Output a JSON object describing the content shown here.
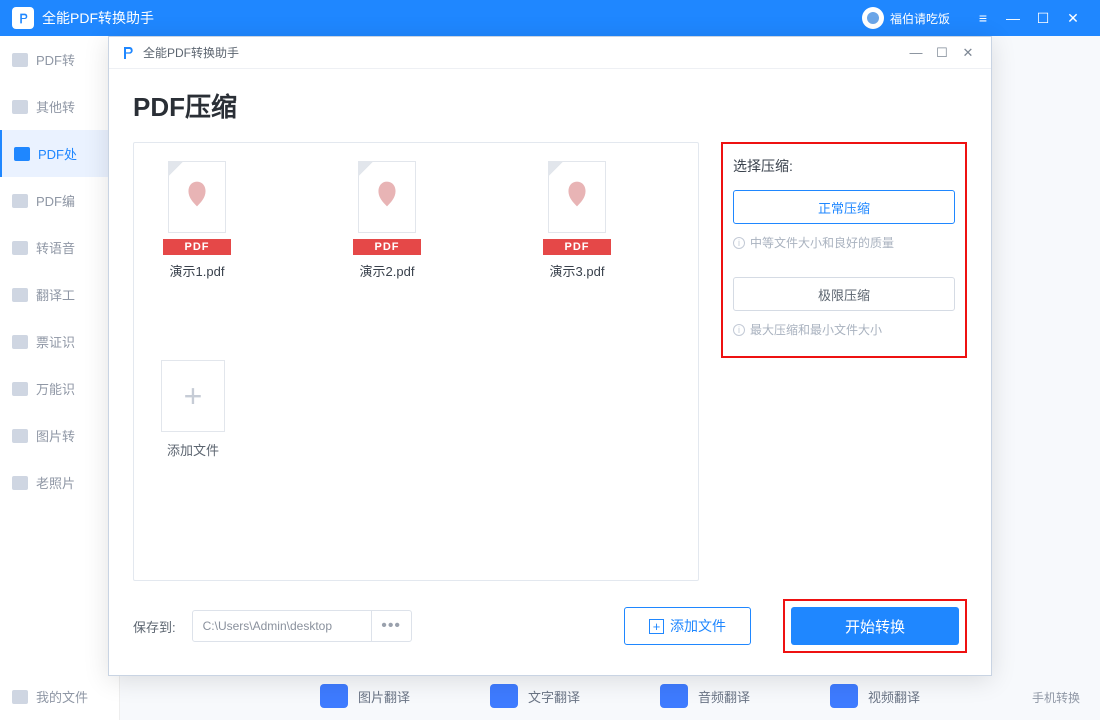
{
  "titlebar": {
    "app_name": "全能PDF转换助手",
    "username": "福伯请吃饭"
  },
  "sidebar": {
    "items": [
      {
        "label": "PDF转"
      },
      {
        "label": "其他转"
      },
      {
        "label": "PDF处"
      },
      {
        "label": "PDF编"
      },
      {
        "label": "转语音"
      },
      {
        "label": "翻译工"
      },
      {
        "label": "票证识"
      },
      {
        "label": "万能识"
      },
      {
        "label": "图片转"
      },
      {
        "label": "老照片"
      }
    ],
    "active_index": 2,
    "my_files": "我的文件"
  },
  "modal": {
    "title": "全能PDF转换助手",
    "heading": "PDF压缩",
    "files": [
      {
        "badge": "PDF",
        "name": "演示1.pdf"
      },
      {
        "badge": "PDF",
        "name": "演示2.pdf"
      },
      {
        "badge": "PDF",
        "name": "演示3.pdf"
      }
    ],
    "add_tile": "添加文件",
    "options": {
      "title": "选择压缩:",
      "normal": "正常压缩",
      "normal_desc": "中等文件大小和良好的质量",
      "extreme": "极限压缩",
      "extreme_desc": "最大压缩和最小文件大小"
    },
    "footer": {
      "save_to": "保存到:",
      "path": "C:\\Users\\Admin\\desktop",
      "browse": "•••",
      "add_file": "添加文件",
      "start": "开始转换"
    }
  },
  "bottom": {
    "items": [
      "图片翻译",
      "文字翻译",
      "音频翻译",
      "视频翻译"
    ],
    "phone": "手机转换"
  }
}
